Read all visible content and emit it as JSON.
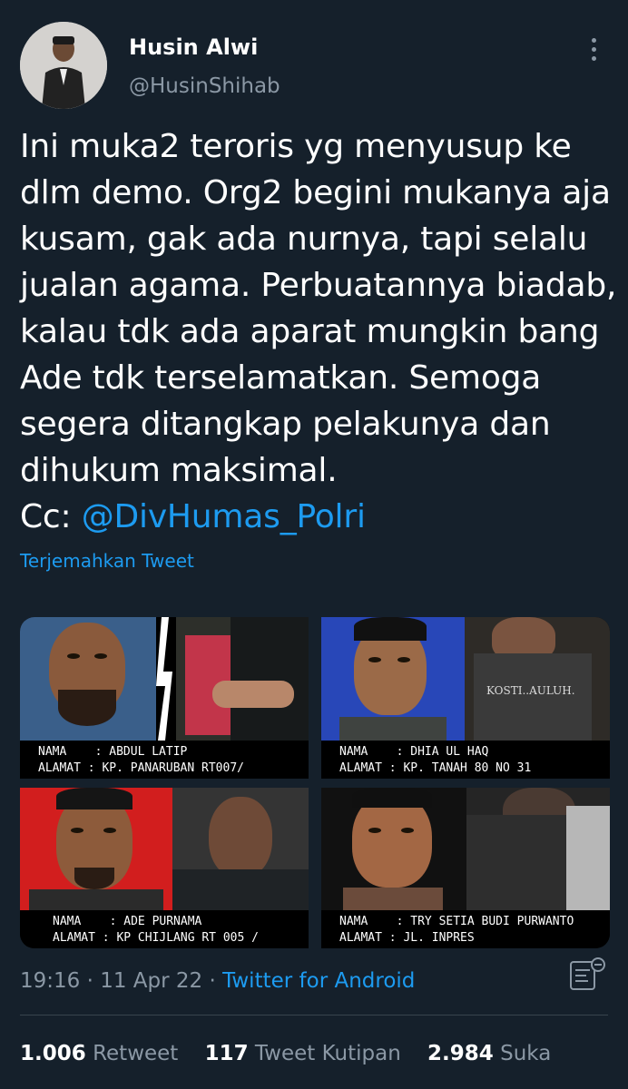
{
  "author": {
    "name": "Husin Alwi",
    "handle": "@HusinShihab"
  },
  "tweet": {
    "lines": [
      "Ini muka2 teroris yg menyusup ke",
      "dlm demo. Org2 begini mukanya aja",
      "kusam, gak ada nurnya, tapi selalu",
      "jualan agama. Perbuatannya biadab,",
      "kalau tdk ada aparat mungkin bang",
      "Ade tdk terselamatkan. Semoga",
      "segera ditangkap pelakunya dan",
      "dihukum maksimal."
    ],
    "cc_label": "Cc: ",
    "mention": "@DivHumas_Polri",
    "translate_label": "Terjemahkan Tweet"
  },
  "media": [
    {
      "caption_line1": "NAMA    : ABDUL LATIP",
      "caption_line2": "ALAMAT : KP. PANARUBAN RT007/"
    },
    {
      "caption_line1": "NAMA    : DHIA UL HAQ",
      "caption_line2": "ALAMAT : KP. TANAH 80 NO 31"
    },
    {
      "caption_line1": "NAMA    : ADE PURNAMA",
      "caption_line2": "ALAMAT : KP CHIJLANG RT 005 /"
    },
    {
      "caption_line1": "NAMA    : TRY SETIA BUDI PURWANTO",
      "caption_line2": "ALAMAT : JL. INPRES"
    }
  ],
  "meta": {
    "time": "19:16",
    "sep1": " · ",
    "date": "11 Apr 22",
    "sep2": " · ",
    "source": "Twitter for Android"
  },
  "stats": {
    "retweets_count": "1.006",
    "retweets_label": "Retweet",
    "quotes_count": "117",
    "quotes_label": "Tweet Kutipan",
    "likes_count": "2.984",
    "likes_label": "Suka"
  },
  "colors": {
    "background": "#15202b",
    "accent": "#1d9bf0",
    "secondary_text": "#8b98a5"
  },
  "icons": {
    "more": "more-vertical-icon",
    "analytics": "analytics-icon"
  }
}
